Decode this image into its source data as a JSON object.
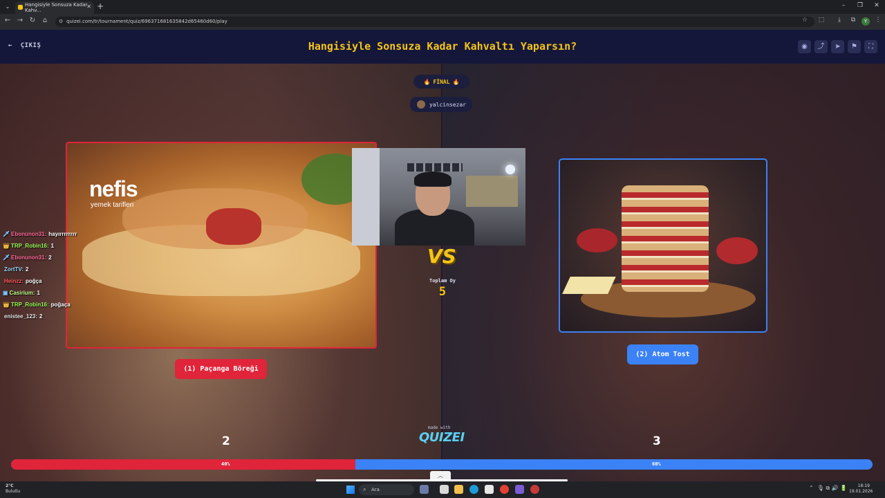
{
  "browser": {
    "tab_title": "Hangisiyle Sonsuza Kadar Kahv...",
    "url": "quizei.com/tr/tournament/quiz/6963716816358​42d65460d60/play",
    "profile_initial": "Y"
  },
  "header": {
    "exit_label": "ÇIKIŞ",
    "title": "Hangisiyle Sonsuza Kadar Kahvaltı Yaparsın?"
  },
  "round": {
    "stage_label": "FİNAL",
    "username": "yalcinsezar",
    "total_votes_label": "Toplam Oy",
    "total_votes": "5",
    "vs_label": "VS"
  },
  "left": {
    "brand_text": "nefis",
    "brand_sub": "yemek tarifleri",
    "button_label": "(1) Paçanga Böreği",
    "votes": "2",
    "percent_label": "40%",
    "share": 0.4
  },
  "right": {
    "button_label": "(2) Atom Tost",
    "votes": "3",
    "percent_label": "60%"
  },
  "footer": {
    "made_with": "made with",
    "logo": "QUIZEI"
  },
  "chat": [
    {
      "user": "Ebonunon31:",
      "msg": "hayırrrrrrrr",
      "color": "#ff6b9b",
      "icon": "sword-icon"
    },
    {
      "user": "TRP_Robin16:",
      "msg": "1",
      "color": "#9bff5a",
      "icon": "crown-icon"
    },
    {
      "user": "Ebonunon31:",
      "msg": "2",
      "color": "#ff6b9b",
      "icon": "sword-icon"
    },
    {
      "user": "ZortTV:",
      "msg": "2",
      "color": "#9bd7ff",
      "icon": ""
    },
    {
      "user": "Heinzz:",
      "msg": "poğça",
      "color": "#ff5a5a",
      "icon": ""
    },
    {
      "user": "Casirium:",
      "msg": "1",
      "color": "#b9ff8a",
      "icon": "badge-icon"
    },
    {
      "user": "TRP_Robin16:",
      "msg": "poğaça",
      "color": "#9bff5a",
      "icon": "crown-icon"
    },
    {
      "user": "enistee_123:",
      "msg": "2",
      "color": "#e6e6e6",
      "icon": ""
    }
  ],
  "taskbar": {
    "temp": "2°C",
    "weather": "Bulutlu",
    "search_placeholder": "Ara",
    "time": "18:19",
    "date": "19.01.2026"
  },
  "colors": {
    "accent_yellow": "#f5c518",
    "left_red": "#e0243a",
    "right_blue": "#3b82f6",
    "header_bg": "#15173a"
  }
}
